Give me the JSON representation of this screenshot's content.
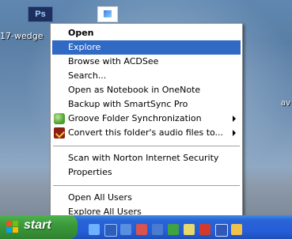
{
  "desktop": {
    "ps_icon_text": "Ps",
    "label_left": "17-wedge",
    "label_right": "av"
  },
  "menu": {
    "items": [
      {
        "label": "Open"
      },
      {
        "label": "Explore"
      },
      {
        "label": "Browse with ACDSee"
      },
      {
        "label": "Search..."
      },
      {
        "label": "Open as Notebook in OneNote"
      },
      {
        "label": "Backup with SmartSync Pro"
      },
      {
        "label": "Groove Folder Synchronization"
      },
      {
        "label": "Convert this folder's audio files to..."
      },
      {
        "label": "Scan with Norton Internet Security"
      },
      {
        "label": "Properties"
      },
      {
        "label": "Open All Users"
      },
      {
        "label": "Explore All Users"
      }
    ]
  },
  "taskbar": {
    "start_label": "start",
    "icons": [
      "ie-icon",
      "media-icon",
      "network-icon",
      "lang-icon",
      "outlook-icon",
      "messenger-icon",
      "pdf-icon",
      "word-icon",
      "folder-icon"
    ]
  }
}
